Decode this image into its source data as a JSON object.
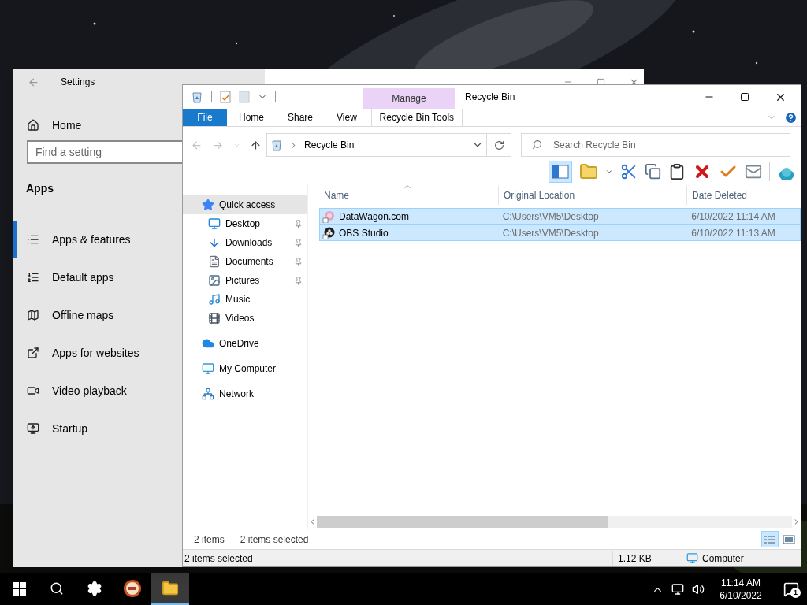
{
  "settings_window": {
    "title": "Settings",
    "home": "Home",
    "search": {
      "placeholder": "Find a setting"
    },
    "section": "Apps",
    "items": [
      {
        "label": "Apps & features",
        "kind": "features",
        "selected": true
      },
      {
        "label": "Default apps",
        "kind": "defaults",
        "selected": false
      },
      {
        "label": "Offline maps",
        "kind": "maps",
        "selected": false
      },
      {
        "label": "Apps for websites",
        "kind": "websites",
        "selected": false
      },
      {
        "label": "Video playback",
        "kind": "video",
        "selected": false
      },
      {
        "label": "Startup",
        "kind": "startup",
        "selected": false
      }
    ]
  },
  "explorer": {
    "title": "Recycle Bin",
    "context_group": "Manage",
    "tabs": [
      {
        "label": "File",
        "kind": "file"
      },
      {
        "label": "Home",
        "kind": "tab"
      },
      {
        "label": "Share",
        "kind": "tab"
      },
      {
        "label": "View",
        "kind": "tab"
      },
      {
        "label": "Recycle Bin Tools",
        "kind": "context"
      }
    ],
    "address": "Recycle Bin",
    "search": {
      "placeholder": "Search Recycle Bin"
    },
    "nav": [
      {
        "label": "Quick access",
        "kind": "star",
        "selected": true,
        "children": [
          {
            "label": "Desktop",
            "kind": "desktop",
            "pinned": true,
            "selected": false
          },
          {
            "label": "Downloads",
            "kind": "download",
            "pinned": true,
            "selected": false
          },
          {
            "label": "Documents",
            "kind": "document",
            "pinned": true,
            "selected": false
          },
          {
            "label": "Pictures",
            "kind": "picture",
            "pinned": true,
            "selected": false
          },
          {
            "label": "Music",
            "kind": "music",
            "pinned": false,
            "selected": false
          },
          {
            "label": "Videos",
            "kind": "video",
            "pinned": false,
            "selected": false
          }
        ]
      },
      {
        "label": "OneDrive",
        "kind": "cloud",
        "selected": false
      },
      {
        "label": "My Computer",
        "kind": "computer",
        "selected": false
      },
      {
        "label": "Network",
        "kind": "network",
        "selected": false
      }
    ],
    "columns": [
      "Name",
      "Original Location",
      "Date Deleted"
    ],
    "rows": [
      {
        "name": "DataWagon.com",
        "kind": "web",
        "location": "C:\\Users\\VM5\\Desktop",
        "date": "6/10/2022 11:14 AM",
        "selected": true
      },
      {
        "name": "OBS Studio",
        "kind": "app",
        "location": "C:\\Users\\VM5\\Desktop",
        "date": "6/10/2022 11:13 AM",
        "selected": true
      }
    ],
    "item_count": "2 items",
    "selection_count": "2 items selected",
    "view_buttons": [
      {
        "kind": "details",
        "selected": true
      },
      {
        "kind": "tiles",
        "selected": false
      }
    ],
    "status_bar": {
      "text": "2 items selected",
      "size": "1.12 KB",
      "zone": "Computer"
    }
  },
  "taskbar": {
    "apps": [
      {
        "kind": "start",
        "selected": false
      },
      {
        "kind": "search",
        "selected": false
      },
      {
        "kind": "settings",
        "selected": false
      },
      {
        "kind": "app",
        "selected": false
      },
      {
        "kind": "explorer",
        "selected": true
      }
    ],
    "time": "11:14 AM",
    "date": "6/10/2022",
    "notifications": "1"
  }
}
